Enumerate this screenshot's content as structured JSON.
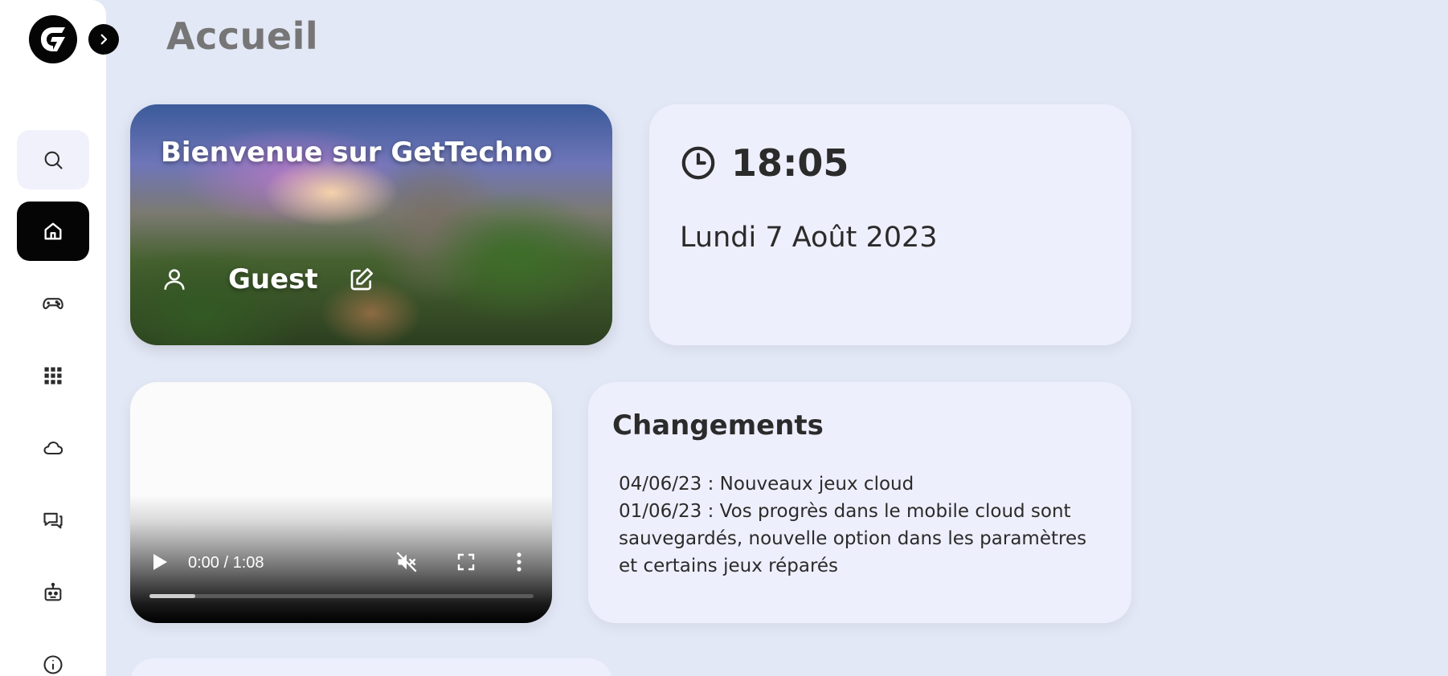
{
  "app": {
    "logo_name": "GetTechno logo",
    "accent": "#050505",
    "background": "#e3e8f6"
  },
  "header": {
    "title": "Accueil"
  },
  "sidebar": {
    "items": [
      {
        "icon": "search-icon"
      },
      {
        "icon": "home-icon",
        "active": true
      },
      {
        "icon": "gamepad-icon"
      },
      {
        "icon": "apps-grid-icon"
      },
      {
        "icon": "cloud-icon"
      },
      {
        "icon": "chat-icon"
      },
      {
        "icon": "robot-icon"
      },
      {
        "icon": "info-icon"
      }
    ]
  },
  "welcome": {
    "title": "Bienvenue sur GetTechno",
    "username": "Guest"
  },
  "clock": {
    "time": "18:05",
    "date": "Lundi 7 Août 2023"
  },
  "video": {
    "time_display": "0:00 / 1:08",
    "progress": 0.12
  },
  "changes": {
    "title": "Changements",
    "items": [
      "04/06/23 : Nouveaux jeux cloud",
      "01/06/23 : Vos progrès dans le mobile cloud sont sauvegardés, nouvelle option dans les paramètres et certains jeux réparés"
    ]
  }
}
